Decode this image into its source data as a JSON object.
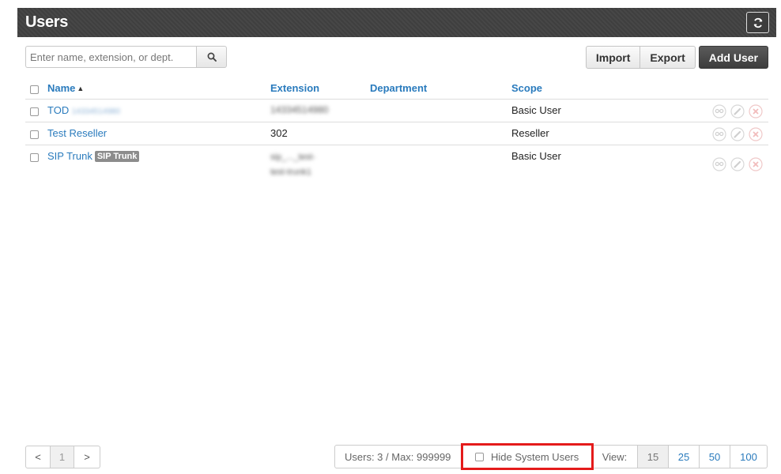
{
  "header": {
    "title": "Users",
    "refresh_icon": "refresh-icon"
  },
  "search": {
    "placeholder": "Enter name, extension, or dept.",
    "value": ""
  },
  "toolbar": {
    "import_label": "Import",
    "export_label": "Export",
    "add_user_label": "Add User"
  },
  "table": {
    "columns": {
      "name": "Name",
      "extension": "Extension",
      "department": "Department",
      "scope": "Scope"
    },
    "rows": [
      {
        "name": "TOD",
        "name_extra": "14334514980",
        "extension": "14334514980",
        "extension_extra": "",
        "department": "",
        "scope": "Basic User",
        "tag": ""
      },
      {
        "name": "Test Reseller",
        "name_extra": "",
        "extension": "302",
        "extension_extra": "",
        "department": "",
        "scope": "Reseller",
        "tag": ""
      },
      {
        "name": "SIP Trunk",
        "name_extra": "",
        "extension": "sip_..._test-",
        "extension_extra": "test-trunk1",
        "department": "",
        "scope": "Basic User",
        "tag": "SIP Trunk"
      }
    ]
  },
  "pagination": {
    "prev": "<",
    "page": "1",
    "next": ">"
  },
  "status": {
    "users_count": "Users: 3 / Max: 999999",
    "hide_system_users": "Hide System Users",
    "view_label": "View:",
    "view_options": [
      "15",
      "25",
      "50",
      "100"
    ],
    "view_selected": "15"
  },
  "colors": {
    "link": "#2a7bbd",
    "header_bg": "#434343",
    "highlight": "#e41b1b"
  }
}
